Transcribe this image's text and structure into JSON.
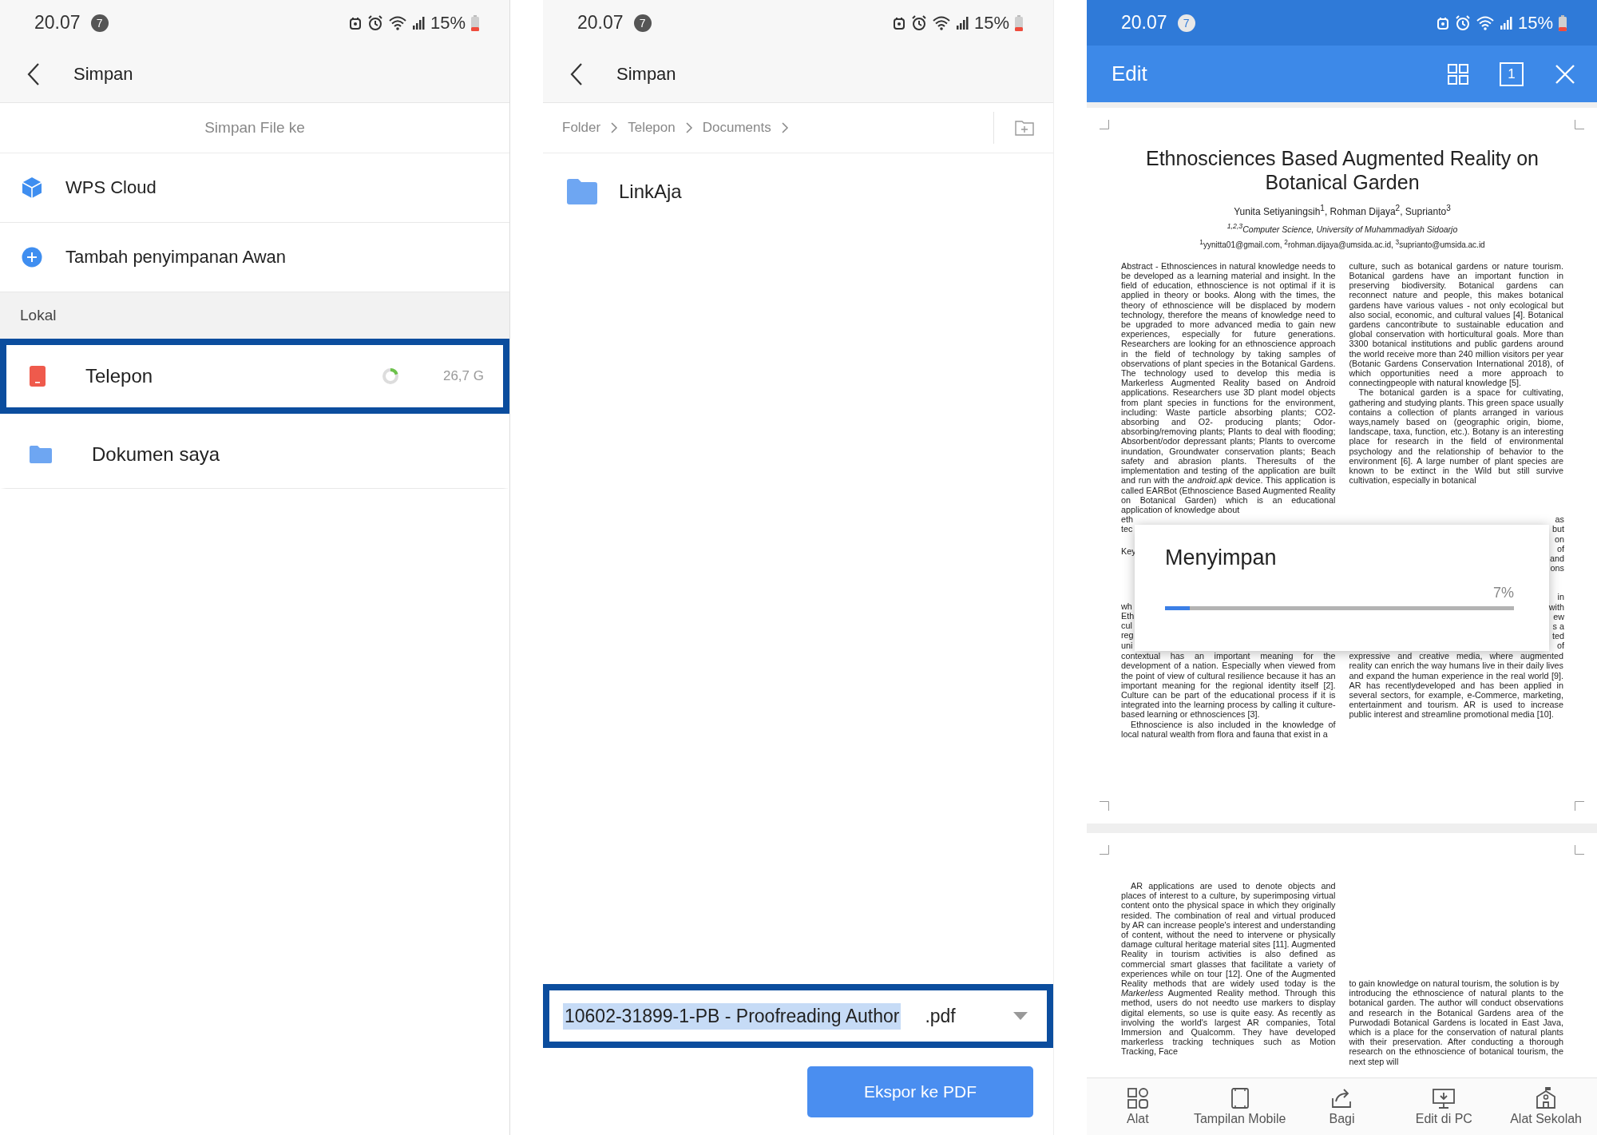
{
  "save_screen": {
    "status_bar": {
      "time": "20.07",
      "notification_count": "7",
      "battery": "15%"
    },
    "title": "Simpan",
    "section_heading": "Simpan File ke",
    "cloud_items": [
      {
        "kind": "cloud",
        "label": "WPS Cloud"
      },
      {
        "kind": "add",
        "label": "Tambah penyimpanan Awan"
      }
    ],
    "local_heading": "Lokal",
    "local_items": [
      {
        "kind": "phone",
        "label": "Telepon",
        "size": "26,7 G",
        "highlighted": true
      },
      {
        "kind": "folder",
        "label": "Dokumen saya",
        "highlighted": false
      }
    ]
  },
  "folder_screen": {
    "status_bar": {
      "time": "20.07",
      "notification_count": "7",
      "battery": "15%"
    },
    "title": "Simpan",
    "breadcrumb": [
      "Folder",
      "Telepon",
      "Documents"
    ],
    "folders": [
      {
        "name": "LinkAja"
      }
    ],
    "file_name": {
      "value": "10602-31899-1-PB - Proofreading Author",
      "value_selected": true,
      "extension": ".pdf",
      "highlighted": true
    },
    "export_button": "Ekspor ke PDF"
  },
  "editor_screen": {
    "status_bar": {
      "time": "20.07",
      "notification_count": "7",
      "battery": "15%"
    },
    "title": "Edit",
    "page_indicator": "1",
    "document": {
      "title": "Ethnosciences Based Augmented Reality on Botanical Garden",
      "authors": "Yunita Setiyaningsih$^{1}$, Rohman Dijaya$^{2}$, Suprianto$^{3}$",
      "affiliation": "$^{1,2,3}$Computer Science, University of Muhammadiyah Sidoarjo",
      "emails": "$^{1}$yynitta01@gmail.com, $^{2}$rohman.dijaya@umsida.ac.id, $^{3}$suprianto@umsida.ac.id",
      "pages": [
        {
          "left": [
            {
              "kind": "paragraph",
              "text": "Abstract - Ethnosciences in natural knowledge needs to be developed as a learning material and insight. In the field of education, ethnoscience is not optimal if it is applied in theory or books. Along with the times, the theory of ethnoscience will be displaced by modern technology, therefore the means of knowledge need to be upgraded to more advanced media to gain new experiences, especially for future generations. Researchers are looking for an ethnoscience approach in the field of technology by taking samples of observations of plant species in the Botanical Gardens. The technology used to develop this media is Markerless Augmented Reality based on Android applications. Researchers use 3D plant model objects from plant species in functions for the environment, including: Waste particle absorbing plants; CO2-absorbing and O2- producing plants; Odor-absorbing/removing plants; Plants to deal with flooding; Absorbent/odor depressant plants; Plants to overcome inundation, Groundwater conservation plants; Beach safety and abrasion plants. Theresults of the implementation and testing of the application are built and run with the *android.apk* device. This application is called EARBot (Ethnoscience Based Augmented Reality on Botanical Garden) which is an educational application of knowledge about"
            },
            {
              "kind": "fragments",
              "lines": [
                "eth",
                "tec"
              ]
            },
            {
              "kind": "fragments",
              "lines": [
                "Key"
              ]
            },
            {
              "kind": "fragments",
              "lines": [
                "wh",
                "Eth",
                "cul",
                "reg",
                "uni"
              ]
            },
            {
              "kind": "paragraph",
              "text": "contextual has an important meaning for the development of a nation. Especially when viewed from the point of view of cultural resilience because it has an important meaning for the regional identity itself [2]. Culture can be part of the educational process if it is integrated into the learning process by calling it culture- based learning or ethnosciences [3]."
            },
            {
              "kind": "indented",
              "text": "Ethnoscience is also included in the knowledge of local natural wealth from flora and fauna that exist in a"
            }
          ],
          "right": [
            {
              "kind": "paragraph",
              "text": "culture, such as botanical gardens or nature tourism. Botanical gardens have an important function in preserving biodiversity. Botanical gardens can reconnect nature and people, this makes botanical gardens have various values - not only ecological but also social, economic, and cultural values [4]. Botanical gardens cancontribute to sustainable education and global conservation with horticultural goals. More than 3300 botanical institutions and public gardens around the world receive more than 240 million visitors per year (Botanic Gardens Conservation International 2018), of which opportunities need a more approach to connectingpeople with natural knowledge [5]."
            },
            {
              "kind": "indented",
              "text": "The botanical garden is a space for cultivating, gathering and studying plants. This green space usually contains a collection of plants arranged in various ways,namely based on (geographic origin, biome, landscape, taxa, function, etc.). Botany is an interesting place for research in the field of environmental psychology and the relationship of behavior to the environment [6]. A large number of plant species are known to be extinct in the Wild but still survive cultivation, especially in botanical"
            },
            {
              "kind": "fragments",
              "lines": [
                "as",
                "but",
                "on",
                "of",
                "and",
                "ons"
              ]
            },
            {
              "kind": "fragments",
              "lines": [
                "in",
                "with",
                "ew",
                "s a",
                "ted",
                "of"
              ]
            },
            {
              "kind": "paragraph",
              "text": "expressive and creative media, where augmented reality can enrich the way humans live in their daily lives and expand the human experience in the real world [9]. AR has recentlydeveloped and has been applied in several sectors, for example, e-Commerce, marketing, entertainment and tourism. AR is used to increase public interest and streamline promotional media [10]."
            }
          ]
        },
        {
          "left": [
            {
              "kind": "indented",
              "text": "AR applications are used to denote objects and places of interest to a culture, by superimposing virtual content onto the physical space in which they originally resided. The combination of real and virtual produced by AR can increase people's interest and understanding of content, without the need to intervene or physically damage cultural heritage material sites [11]. Augmented Reality in tourism activities is also defined as commercial smart glasses that facilitate a variety of experiences while on tour [12]. One of the Augmented Reality methods that are widely used today is the *Markerless* Augmented Reality method. Through this method, users do not needto use markers to display digital elements, so use is quite easy. As recently as involving the world's largest AR companies, Total Immersion and Qualcomm. They have developed markerless tracking techniques such as Motion Tracking, Face"
            }
          ],
          "right": [
            {
              "kind": "paragraph",
              "text": "to gain knowledge on natural tourism, the solution is by"
            },
            {
              "kind": "paragraph",
              "text": "introducing the ethnoscience of natural plants to the botanical garden. The author will conduct observations and research in the Botanical Gardens area of the Purwodadi Botanical Gardens is located in East Java, which is a place for the conservation of natural plants with their preservation. After conducting a thorough research on the ethnoscience of botanical tourism, the next step will"
            }
          ]
        }
      ]
    },
    "dialog": {
      "title": "Menyimpan",
      "reading": "7%",
      "level": 0.07
    },
    "toolbar": [
      {
        "kind": "tools",
        "label": "Alat"
      },
      {
        "kind": "mobile",
        "label": "Tampilan Mobile"
      },
      {
        "kind": "share",
        "label": "Bagi"
      },
      {
        "kind": "desktop",
        "label": "Edit di PC"
      },
      {
        "kind": "school",
        "label": "Alat Sekolah"
      }
    ]
  }
}
